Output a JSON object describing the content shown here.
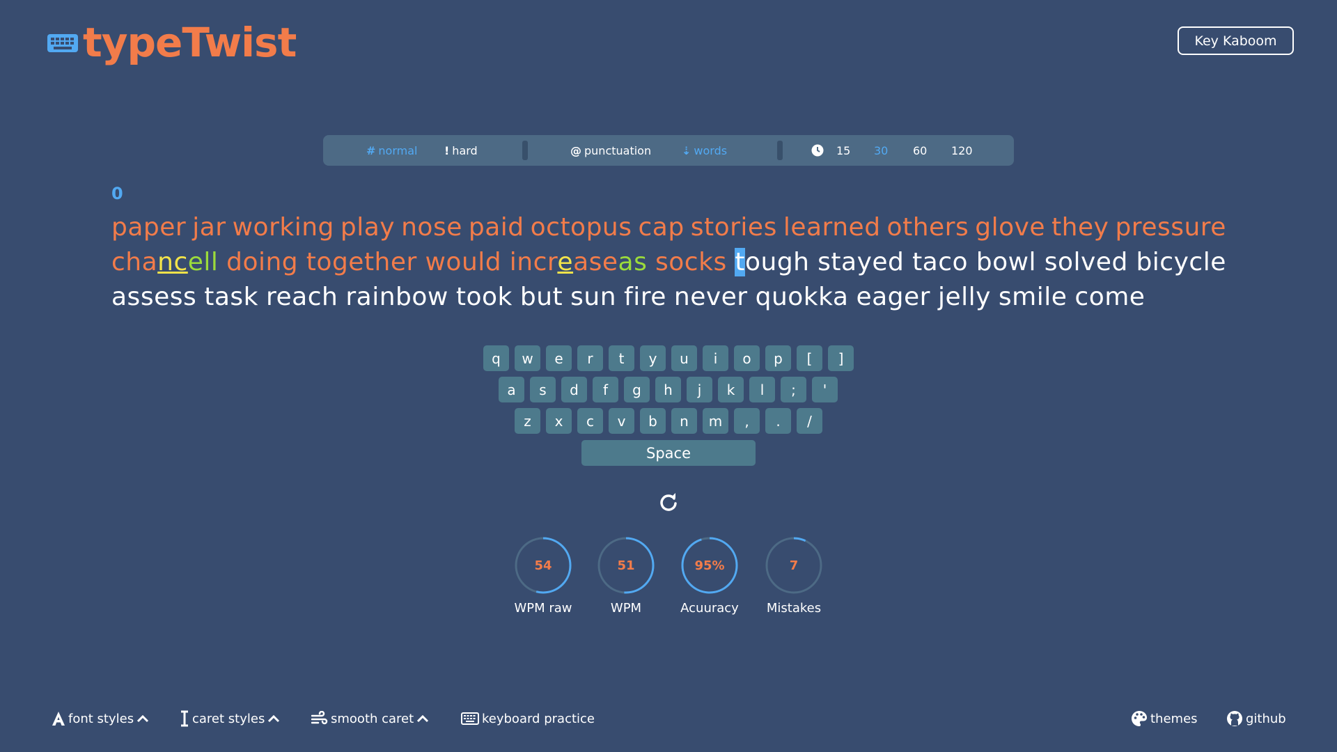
{
  "app": {
    "name": "typeTwist"
  },
  "header": {
    "kaboom_label": "Key Kaboom"
  },
  "modebar": {
    "difficulty": [
      {
        "symbol": "#",
        "label": "normal",
        "active": true
      },
      {
        "symbol": "!",
        "label": "hard",
        "active": false
      }
    ],
    "toggles": [
      {
        "symbol": "@",
        "label": "punctuation",
        "active": false
      },
      {
        "symbol": "⇣",
        "label": "words",
        "active": true
      }
    ],
    "times": [
      {
        "label": "15",
        "active": false
      },
      {
        "label": "30",
        "active": true
      },
      {
        "label": "60",
        "active": false
      },
      {
        "label": "120",
        "active": false
      }
    ]
  },
  "counter": "0",
  "text": {
    "line1": [
      "paper",
      "jar",
      "working",
      "play",
      "nose",
      "paid",
      "octopus",
      "cap",
      "stories",
      "learned",
      "others",
      "glove",
      "they",
      "pressure"
    ],
    "line2": {
      "cancell": {
        "a": "cha",
        "b": "nc",
        "c": "ell"
      },
      "typed_words": [
        "doing",
        "together",
        "would"
      ],
      "increase": {
        "a": "incr",
        "b": "e",
        "c": "ase",
        "d": "as"
      },
      "socks": "socks",
      "tough": {
        "caret": "t",
        "rest": "ough"
      },
      "pending": [
        "stayed",
        "taco",
        "bowl",
        "solved",
        "bicycle"
      ]
    },
    "line3": [
      "assess",
      "task",
      "reach",
      "rainbow",
      "took",
      "but",
      "sun",
      "fire",
      "never",
      "quokka",
      "eager",
      "jelly",
      "smile",
      "come"
    ]
  },
  "keyboard": {
    "row1": [
      "q",
      "w",
      "e",
      "r",
      "t",
      "y",
      "u",
      "i",
      "o",
      "p",
      "[",
      "]"
    ],
    "row2": [
      "a",
      "s",
      "d",
      "f",
      "g",
      "h",
      "j",
      "k",
      "l",
      ";",
      "'"
    ],
    "row3": [
      "z",
      "x",
      "c",
      "v",
      "b",
      "n",
      "m",
      ",",
      ".",
      "/"
    ],
    "space": "Space"
  },
  "stats": [
    {
      "value": "54",
      "label": "WPM raw",
      "fraction": 0.54
    },
    {
      "value": "51",
      "label": "WPM",
      "fraction": 0.51
    },
    {
      "value": "95%",
      "label": "Acuuracy",
      "fraction": 0.95
    },
    {
      "value": "7",
      "label": "Mistakes",
      "fraction": 0.07
    }
  ],
  "footer": {
    "font_styles": "font styles",
    "caret_styles": "caret styles",
    "smooth_caret": "smooth caret",
    "keyboard_practice": "keyboard practice",
    "themes": "themes",
    "github": "github"
  },
  "colors": {
    "background": "#384c6f",
    "accent_orange": "#f27c4a",
    "accent_blue": "#52a9f2",
    "error_yellow": "#f2e34a",
    "extra_green": "#9bdb3b",
    "key": "#4d7a8c",
    "bar": "#4d6a85"
  }
}
